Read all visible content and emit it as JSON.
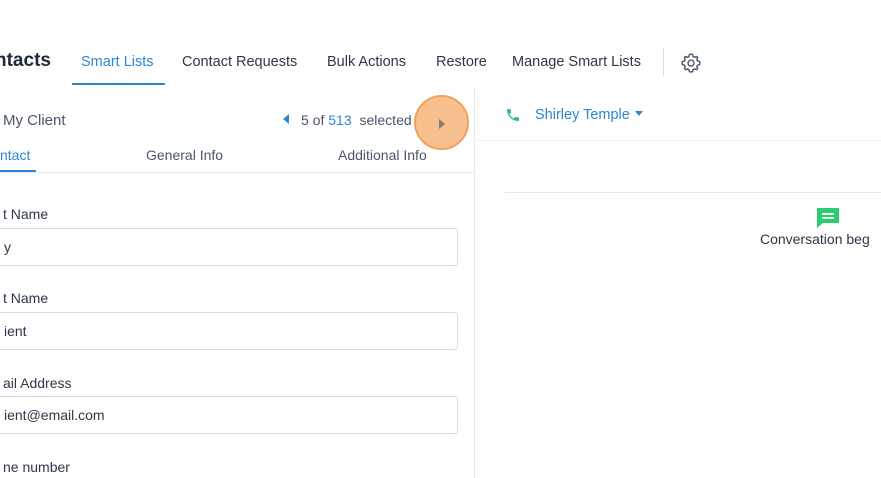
{
  "header": {
    "app_title": "ntacts",
    "tabs": [
      {
        "label": "Smart Lists",
        "active": true
      },
      {
        "label": "Contact Requests",
        "active": false
      },
      {
        "label": "Bulk Actions",
        "active": false
      },
      {
        "label": "Restore",
        "active": false
      },
      {
        "label": "Manage Smart Lists",
        "active": false
      }
    ],
    "settings_icon": "gear-icon"
  },
  "contact_panel": {
    "name": "My Client",
    "pager": {
      "position": "5 of",
      "total": "513",
      "suffix": "selected"
    },
    "tabs": [
      {
        "label": "ntact",
        "active": true
      },
      {
        "label": "General Info",
        "active": false
      },
      {
        "label": "Additional Info",
        "active": false
      }
    ],
    "fields": [
      {
        "label": "t Name",
        "value": "y"
      },
      {
        "label": "t Name",
        "value": "ient"
      },
      {
        "label": "ail Address",
        "value": "ient@email.com"
      },
      {
        "label": "ne number",
        "value": ""
      }
    ]
  },
  "conversation_panel": {
    "contact": "Shirley Temple",
    "message": "Conversation beg"
  },
  "colors": {
    "accent": "#2b87d3",
    "phone_green": "#2fbf71",
    "chat_green": "#2ecc71",
    "highlight_orange": "#f5a664"
  }
}
